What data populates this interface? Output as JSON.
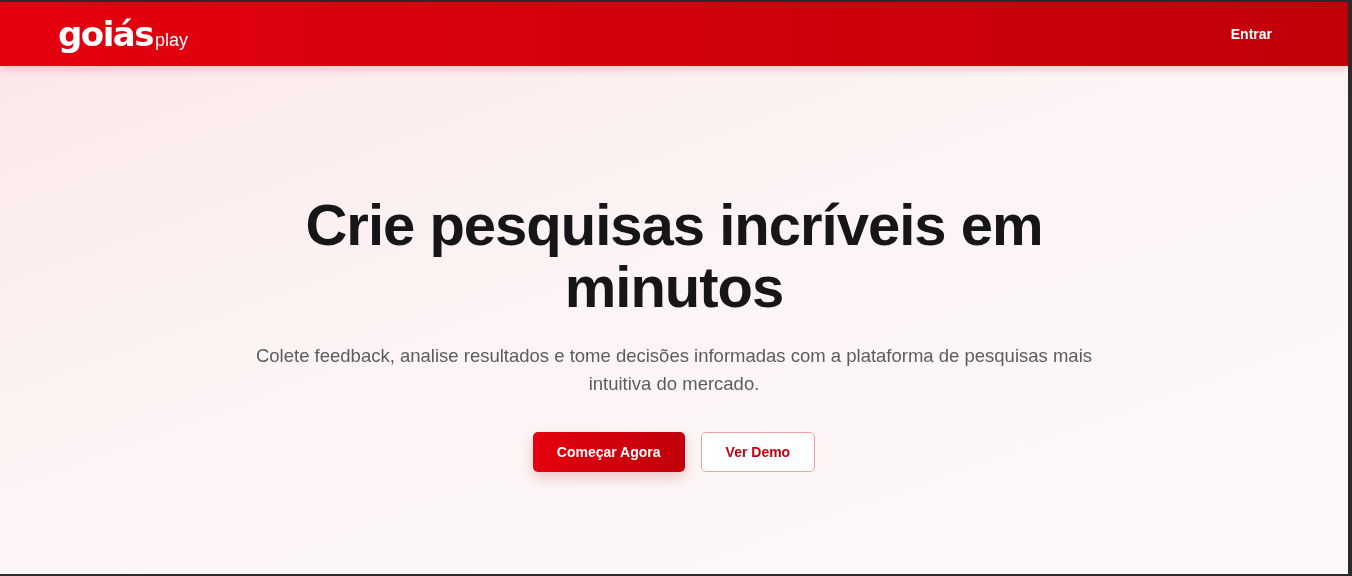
{
  "header": {
    "logo": {
      "brand": "goiás",
      "suffix": "play"
    },
    "login": "Entrar"
  },
  "hero": {
    "title": "Crie pesquisas incríveis em minutos",
    "subtitle": "Colete feedback, analise resultados e tome decisões informadas com a plataforma de pesquisas mais intuitiva do mercado.",
    "buttons": [
      {
        "label": "Começar Agora",
        "kind": "primary"
      },
      {
        "label": "Ver Demo",
        "kind": "secondary"
      }
    ]
  }
}
